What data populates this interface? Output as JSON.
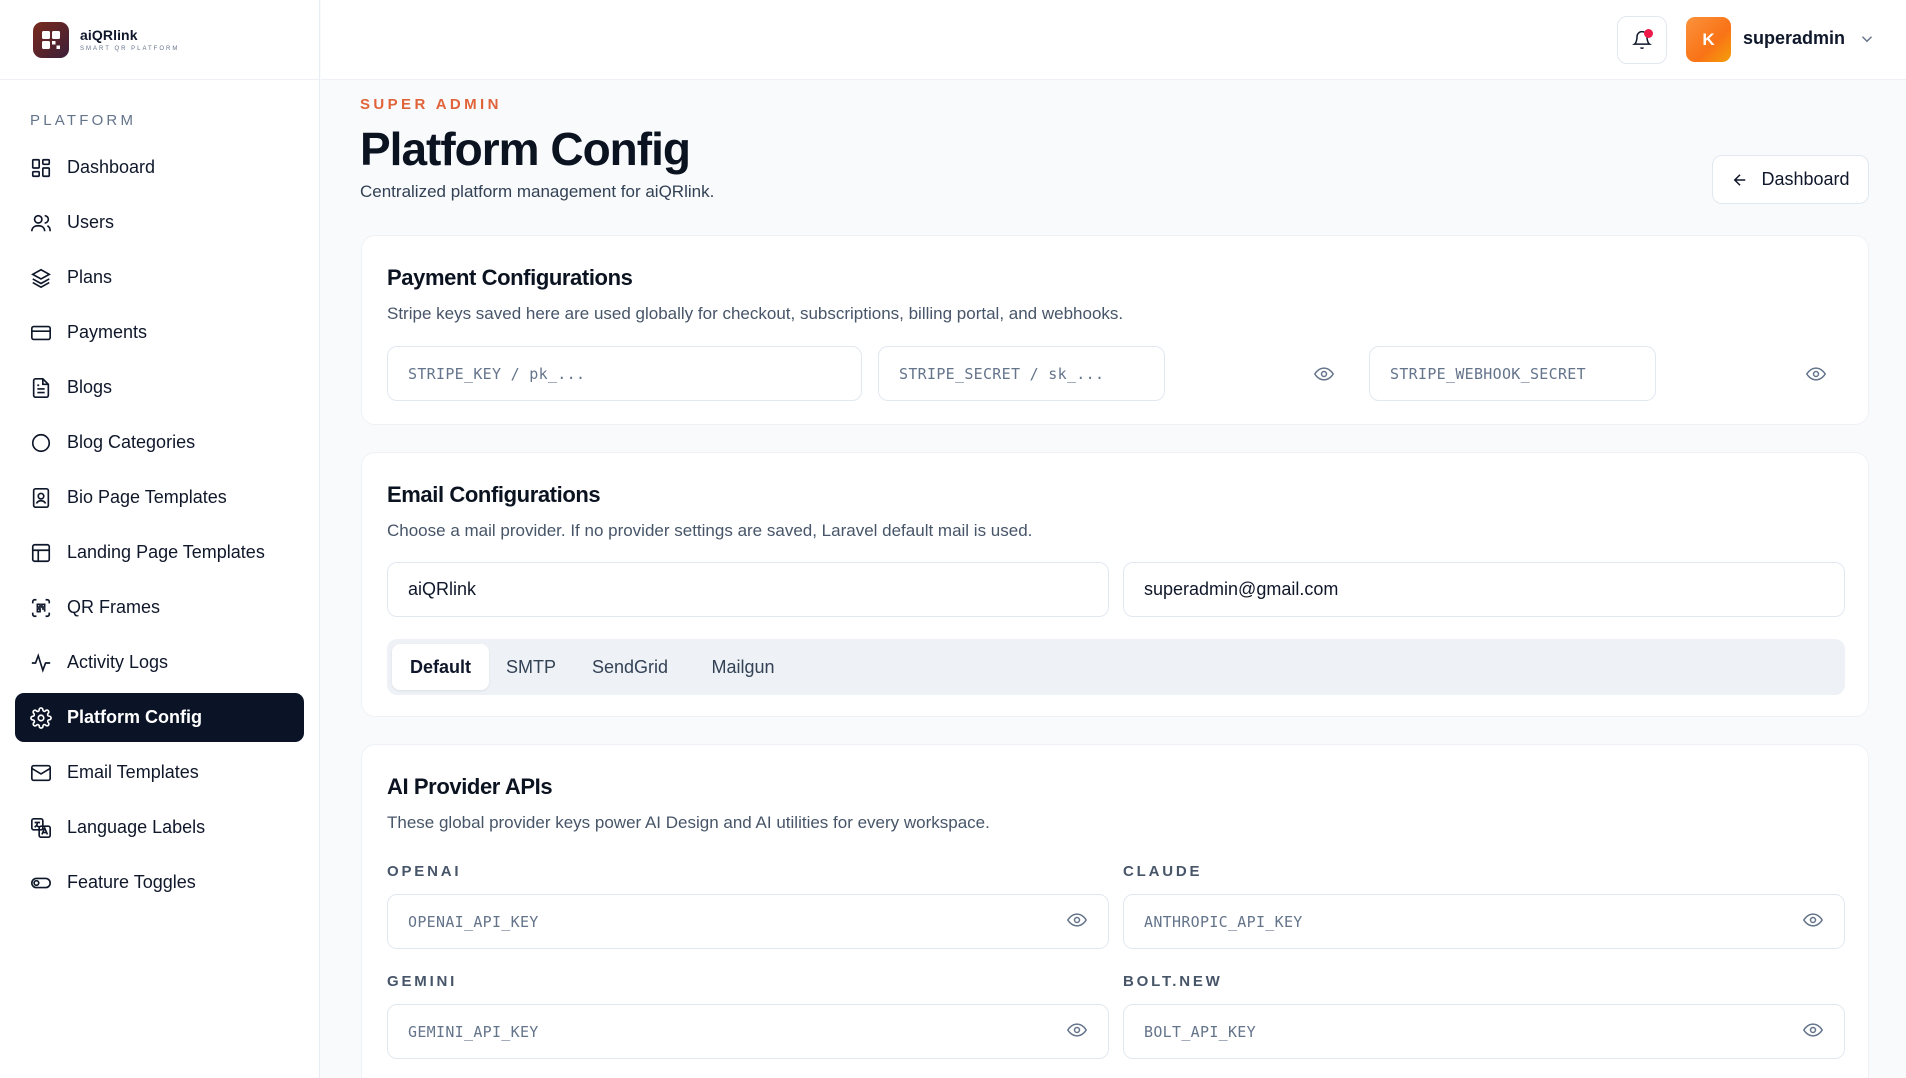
{
  "brand": {
    "name": "aiQRlink",
    "tagline": "SMART QR PLATFORM"
  },
  "sidebar": {
    "section_label": "PLATFORM",
    "items": [
      {
        "label": "Dashboard",
        "icon": "grid-icon"
      },
      {
        "label": "Users",
        "icon": "users-icon"
      },
      {
        "label": "Plans",
        "icon": "layers-icon"
      },
      {
        "label": "Payments",
        "icon": "credit-card-icon"
      },
      {
        "label": "Blogs",
        "icon": "document-icon"
      },
      {
        "label": "Blog Categories",
        "icon": "circle-icon"
      },
      {
        "label": "Bio Page Templates",
        "icon": "contact-icon"
      },
      {
        "label": "Landing Page Templates",
        "icon": "layout-icon"
      },
      {
        "label": "QR Frames",
        "icon": "scan-icon"
      },
      {
        "label": "Activity Logs",
        "icon": "activity-icon"
      },
      {
        "label": "Platform Config",
        "icon": "gear-icon",
        "active": true
      },
      {
        "label": "Email Templates",
        "icon": "mail-icon"
      },
      {
        "label": "Language Labels",
        "icon": "languages-icon"
      },
      {
        "label": "Feature Toggles",
        "icon": "toggle-icon"
      }
    ]
  },
  "header": {
    "avatar_initial": "K",
    "username": "superadmin"
  },
  "page": {
    "eyebrow": "SUPER ADMIN",
    "title": "Platform Config",
    "subtitle": "Centralized platform management for aiQRlink.",
    "back_button": "Dashboard"
  },
  "payment": {
    "title": "Payment Configurations",
    "description": "Stripe keys saved here are used globally for checkout, subscriptions, billing portal, and webhooks.",
    "stripe_key_placeholder": "STRIPE_KEY / pk_...",
    "stripe_secret_placeholder": "STRIPE_SECRET / sk_...",
    "webhook_secret_placeholder": "STRIPE_WEBHOOK_SECRET"
  },
  "email": {
    "title": "Email Configurations",
    "description": "Choose a mail provider. If no provider settings are saved, Laravel default mail is used.",
    "from_name": "aiQRlink",
    "from_address": "superadmin@gmail.com",
    "tabs": [
      "Default",
      "SMTP",
      "SendGrid",
      "Mailgun"
    ],
    "active_tab": "Default"
  },
  "ai": {
    "title": "AI Provider APIs",
    "description": "These global provider keys power AI Design and AI utilities for every workspace.",
    "providers": [
      {
        "label": "OPENAI",
        "placeholder": "OPENAI_API_KEY"
      },
      {
        "label": "CLAUDE",
        "placeholder": "ANTHROPIC_API_KEY"
      },
      {
        "label": "GEMINI",
        "placeholder": "GEMINI_API_KEY"
      },
      {
        "label": "BOLT.NEW",
        "placeholder": "BOLT_API_KEY"
      }
    ]
  },
  "colors": {
    "accent": "#e1633a",
    "active_nav_bg": "#0b1326",
    "notification_dot": "#ef1a4a",
    "avatar": "#f97316"
  }
}
